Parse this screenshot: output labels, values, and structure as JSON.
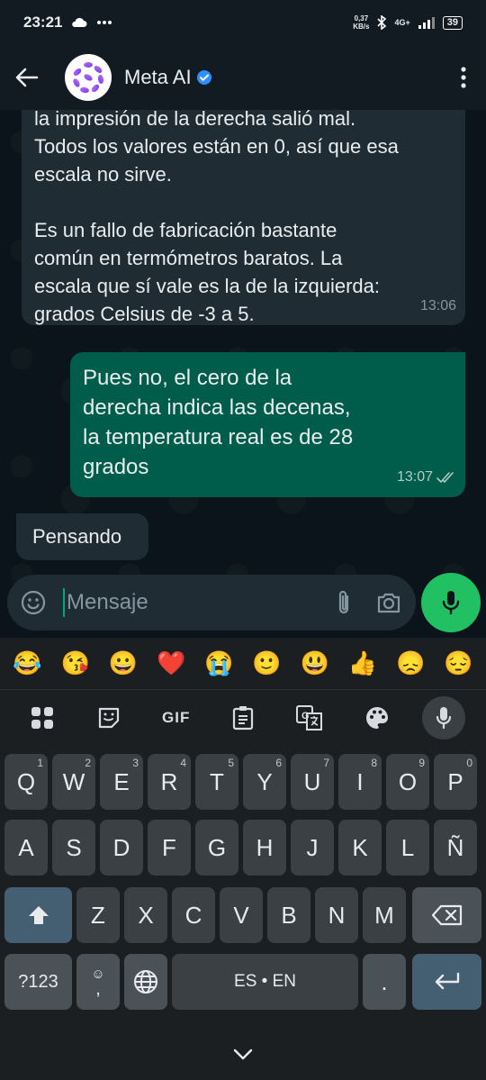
{
  "status_bar": {
    "time": "23:21",
    "speed_value": "0,37",
    "speed_unit": "KB/s",
    "network": "4G+",
    "battery": "39"
  },
  "header": {
    "contact_name": "Meta AI",
    "back_icon": "arrow-left-icon",
    "verified_icon": "verified-badge-icon",
    "menu_icon": "more-vertical-icon"
  },
  "messages": [
    {
      "direction": "incoming",
      "text": "la impresión de la derecha salió mal.\nTodos los valores están en 0, así que esa\nescala no sirve.\n\nEs un fallo de fabricación bastante\ncomún en termómetros baratos. La\nescala que sí vale es la de la izquierda:\ngrados Celsius de -3 a 5.",
      "time": "13:06"
    },
    {
      "direction": "outgoing",
      "text": "Pues no, el cero de la\nderecha indica las decenas,\nla temperatura real es de 28\ngrados",
      "time": "13:07"
    },
    {
      "direction": "incoming",
      "text": "Pensando"
    }
  ],
  "composer": {
    "placeholder": "Mensaje"
  },
  "keyboard": {
    "emoji_suggestions": [
      "😂",
      "😘",
      "😀",
      "❤️",
      "😭",
      "🙂",
      "😃",
      "👍",
      "😞",
      "😔"
    ],
    "tools": [
      "grid-icon",
      "sticker-icon",
      "GIF",
      "clipboard-icon",
      "translate-icon",
      "palette-icon",
      "mic-icon"
    ],
    "row1": [
      {
        "key": "Q",
        "hint": "1"
      },
      {
        "key": "W",
        "hint": "2"
      },
      {
        "key": "E",
        "hint": "3"
      },
      {
        "key": "R",
        "hint": "4"
      },
      {
        "key": "T",
        "hint": "5"
      },
      {
        "key": "Y",
        "hint": "6"
      },
      {
        "key": "U",
        "hint": "7"
      },
      {
        "key": "I",
        "hint": "8"
      },
      {
        "key": "O",
        "hint": "9"
      },
      {
        "key": "P",
        "hint": "0"
      }
    ],
    "row2": [
      "A",
      "S",
      "D",
      "F",
      "G",
      "H",
      "J",
      "K",
      "L",
      "Ñ"
    ],
    "row3": [
      "Z",
      "X",
      "C",
      "V",
      "B",
      "N",
      "M"
    ],
    "symbols_key": "?123",
    "comma_key": ",",
    "space_label": "ES • EN",
    "period_key": "."
  }
}
